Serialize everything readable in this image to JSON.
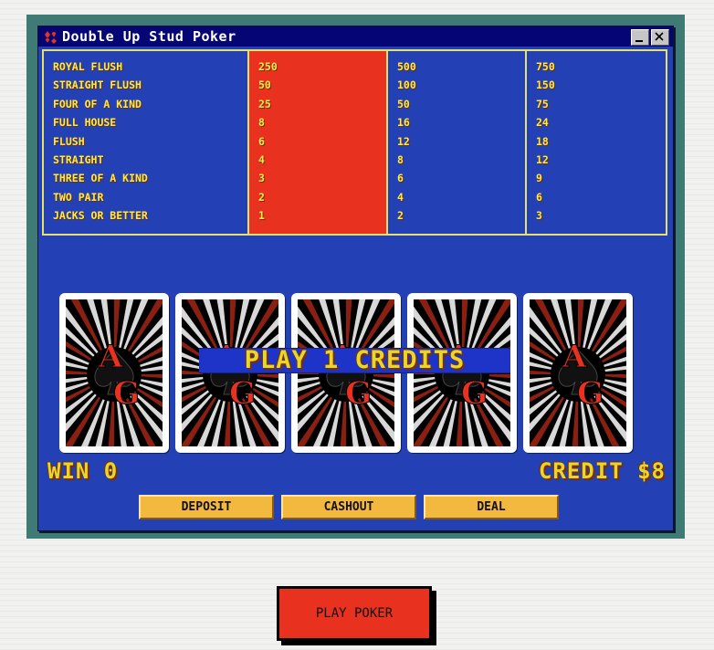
{
  "window": {
    "title": "Double Up Stud Poker",
    "icon": "cards-suit-icon",
    "minimize_icon": "minimize-icon",
    "close_icon": "close-icon"
  },
  "paytable": {
    "hands": [
      "ROYAL FLUSH",
      "STRAIGHT FLUSH",
      "FOUR OF A KIND",
      "FULL HOUSE",
      "FLUSH",
      "STRAIGHT",
      "THREE OF A KIND",
      "TWO PAIR",
      "JACKS OR BETTER"
    ],
    "col1": [
      "250",
      "50",
      "25",
      "8",
      "6",
      "4",
      "3",
      "2",
      "1"
    ],
    "col2": [
      "500",
      "100",
      "50",
      "16",
      "12",
      "8",
      "6",
      "4",
      "2"
    ],
    "col3": [
      "750",
      "150",
      "75",
      "24",
      "18",
      "12",
      "9",
      "6",
      "3"
    ],
    "highlight_color": "#e8321f"
  },
  "cards": {
    "count": 5,
    "back_logo": "AG",
    "face": "back"
  },
  "status": {
    "banner": "PLAY 1 CREDITS",
    "win": "WIN 0",
    "credit": "CREDIT $8"
  },
  "buttons": {
    "deposit": "DEPOSIT",
    "cashout": "CASHOUT",
    "deal": "DEAL",
    "play": "PLAY POKER"
  },
  "colors": {
    "table_blue": "#2340b4",
    "title_bar": "#050573",
    "text_yellow": "#ffe94a",
    "button_gold": "#f3b93f",
    "frame_teal": "#3f7a74",
    "accent_red": "#e8321f"
  }
}
